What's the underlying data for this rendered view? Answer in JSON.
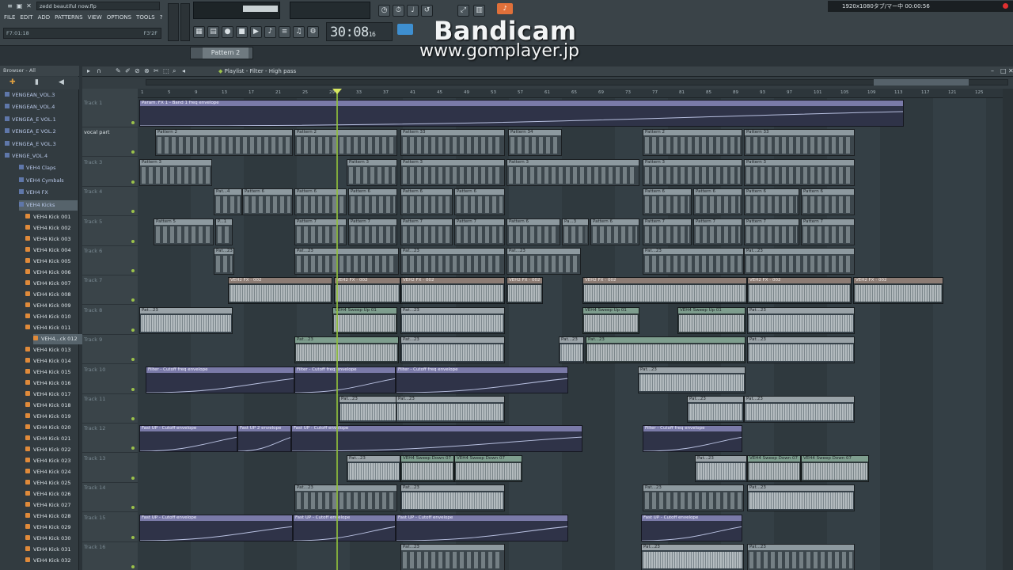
{
  "window": {
    "title": "zedd beautiful now.flp"
  },
  "menu": [
    "FILE",
    "EDIT",
    "ADD",
    "PATTERNS",
    "VIEW",
    "OPTIONS",
    "TOOLS",
    "?"
  ],
  "hint": {
    "left": "F7:01:18",
    "right": "F3'2F"
  },
  "transport": {
    "time": "30:08",
    "time_small": "16",
    "pattern": "Pattern 2"
  },
  "watermark": {
    "line1": "Bandicam",
    "line2": "www.gomplayer.jp"
  },
  "recording": {
    "text": "1920x1080タブ/マー中 00:00:56"
  },
  "browser": {
    "header": "Browser - All",
    "folders": [
      "VENGEAN_VOL.3",
      "VENGEAN_VOL.4",
      "VENGEA_E VOL.1",
      "VENGEA_E VOL.2",
      "VENGEA_E VOL.3",
      "VENGE_VOL.4",
      "VEH4 Claps",
      "VEH4 Cymbals",
      "VEH4 FX",
      "VEH4 Kicks"
    ],
    "files": [
      "VEH4 Kick 001",
      "VEH4 Kick 002",
      "VEH4 Kick 003",
      "VEH4 Kick 004",
      "VEH4 Kick 005",
      "VEH4 Kick 006",
      "VEH4 Kick 007",
      "VEH4 Kick 008",
      "VEH4 Kick 009",
      "VEH4 Kick 010",
      "VEH4 Kick 011",
      "VEH4...ck 012",
      "VEH4 Kick 013",
      "VEH4 Kick 014",
      "VEH4 Kick 015",
      "VEH4 Kick 016",
      "VEH4 Kick 017",
      "VEH4 Kick 018",
      "VEH4 Kick 019",
      "VEH4 Kick 020",
      "VEH4 Kick 021",
      "VEH4 Kick 022",
      "VEH4 Kick 023",
      "VEH4 Kick 024",
      "VEH4 Kick 025",
      "VEH4 Kick 026",
      "VEH4 Kick 027",
      "VEH4 Kick 028",
      "VEH4 Kick 029",
      "VEH4 Kick 030",
      "VEH4 Kick 031",
      "VEH4 Kick 032"
    ]
  },
  "playlist": {
    "title": "Playlist - Filter - High pass",
    "ruler": [
      "1",
      "5",
      "9",
      "13",
      "17",
      "21",
      "25",
      "29",
      "33",
      "37",
      "41",
      "45",
      "49",
      "53",
      "57",
      "61",
      "65",
      "69",
      "73",
      "77",
      "81",
      "85",
      "89",
      "93",
      "97",
      "101",
      "105",
      "109",
      "113",
      "117",
      "121",
      "125"
    ],
    "tracks": [
      "Track 1",
      "vocal part",
      "Track 3",
      "Track 4",
      "Track 5",
      "Track 6",
      "Track 7",
      "Track 8",
      "Track 9",
      "Track 10",
      "Track 11",
      "Track 12",
      "Track 13",
      "Track 14",
      "Track 15",
      "Track 16"
    ],
    "clip_labels": {
      "reverb": "Param. FX 1 - Band 1 freq envelope",
      "pattern2": "Pattern 2",
      "pattern33": "Pattern 33",
      "pattern34": "Pattern 34",
      "pattern3": "Pattern 3",
      "pattern6": "Pattern 6",
      "pat4": "Pat...4",
      "pattern5": "Pattern 5",
      "pattern7": "Pattern 7",
      "p1": "P...1",
      "pa": "Pa...3",
      "fx1": "VEH2 FX - 002",
      "sweepup": "VEH4 Sweep Up 01",
      "filter": "Filter - Cutoff freq envelope",
      "fastup": "Fast UP - Cutoff envelope",
      "fastup2": "Fast UP 2 envelope",
      "sweepdown": "VEH4 Sweep Down 07",
      "pat23": "Pat...23"
    }
  }
}
